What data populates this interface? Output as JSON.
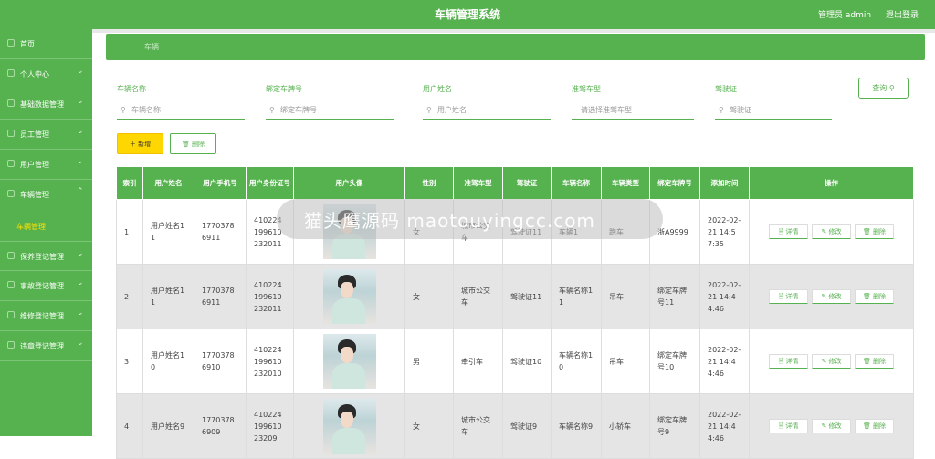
{
  "header": {
    "title": "车辆管理系统",
    "user": "管理员 admin",
    "logout": "退出登录"
  },
  "sidebar": {
    "items": [
      {
        "label": "首页"
      },
      {
        "label": "个人中心"
      },
      {
        "label": "基础数据管理"
      },
      {
        "label": "员工管理"
      },
      {
        "label": "用户管理"
      },
      {
        "label": "车辆管理"
      },
      {
        "label": "保养登记管理"
      },
      {
        "label": "事故登记管理"
      },
      {
        "label": "维修登记管理"
      },
      {
        "label": "违章登记管理"
      }
    ],
    "sub_active": "车辆管理"
  },
  "breadcrumb": {
    "current": "车辆"
  },
  "filters": [
    {
      "label": "车辆名称",
      "placeholder": "车辆名称"
    },
    {
      "label": "绑定车牌号",
      "placeholder": "绑定车牌号"
    },
    {
      "label": "用户姓名",
      "placeholder": "用户姓名"
    },
    {
      "label": "准驾车型",
      "placeholder": "请选择准驾车型"
    },
    {
      "label": "驾驶证",
      "placeholder": "驾驶证"
    }
  ],
  "buttons": {
    "query": "查询 ⚲",
    "add": "＋ 新增",
    "delete": "🗑 删除"
  },
  "table": {
    "headers": [
      "索引",
      "用户姓名",
      "用户手机号",
      "用户身份证号",
      "用户头像",
      "性别",
      "准驾车型",
      "驾驶证",
      "车辆名称",
      "车辆类型",
      "绑定车牌号",
      "添加时间",
      "操作"
    ],
    "ops": {
      "detail": "🗎 详情",
      "edit": "✎ 修改",
      "delete": "🗑 删除"
    },
    "rows": [
      {
        "index": "1",
        "name": "用户姓名11",
        "phone": "17703786911",
        "id_card": "41022419961023​2011",
        "gender": "女",
        "license_type": "城市公交车",
        "license": "驾驶证11",
        "car_name": "车辆1",
        "car_type": "跑车",
        "plate": "浙A9999",
        "time": "2022-02-21 14:57:35"
      },
      {
        "index": "2",
        "name": "用户姓名11",
        "phone": "17703786911",
        "id_card": "410224199610232011",
        "gender": "女",
        "license_type": "城市公交车",
        "license": "驾驶证11",
        "car_name": "车辆名称11",
        "car_type": "吊车",
        "plate": "绑定车牌号11",
        "time": "2022-02-21 14:44:46"
      },
      {
        "index": "3",
        "name": "用户姓名10",
        "phone": "17703786910",
        "id_card": "410224199610232010",
        "gender": "男",
        "license_type": "牵引车",
        "license": "驾驶证10",
        "car_name": "车辆名称10",
        "car_type": "吊车",
        "plate": "绑定车牌号10",
        "time": "2022-02-21 14:44:46"
      },
      {
        "index": "4",
        "name": "用户姓名9",
        "phone": "17703786909",
        "id_card": "41022419961023209",
        "gender": "女",
        "license_type": "城市公交车",
        "license": "驾驶证9",
        "car_name": "车辆名称9",
        "car_type": "小轿车",
        "plate": "绑定车牌号9",
        "time": "2022-02-21 14:44:46"
      }
    ]
  },
  "watermark": "猫头鹰源码 maotouyingcc.com",
  "colors": {
    "primary": "#56b14f",
    "accent": "#ffd700",
    "row_alt": "#e5e5e5"
  }
}
